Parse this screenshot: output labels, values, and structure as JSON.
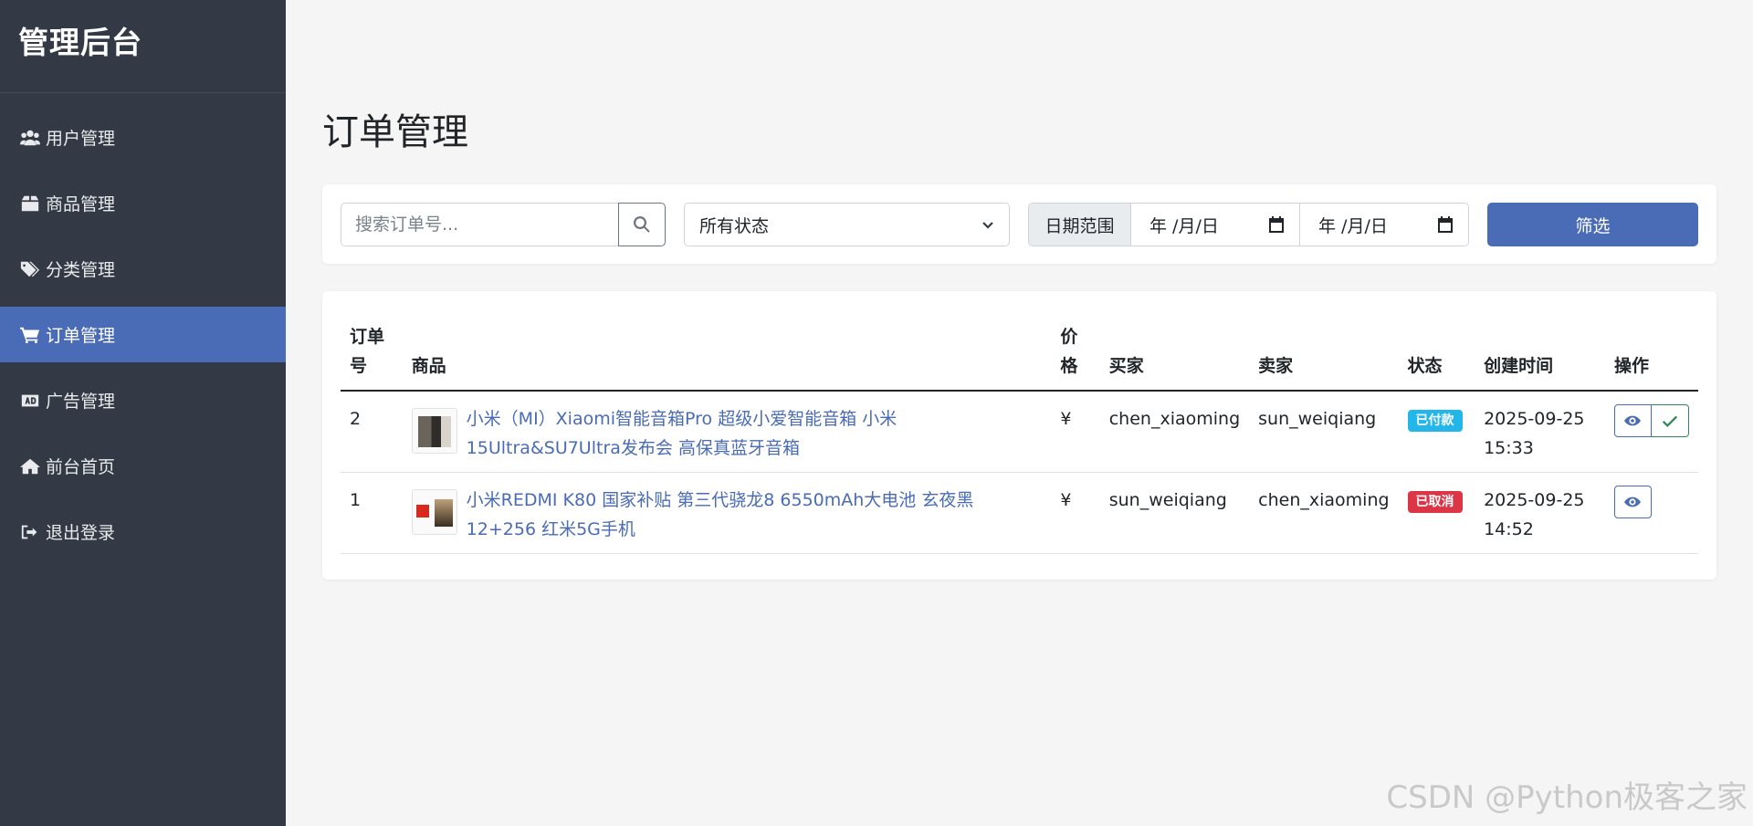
{
  "sidebar": {
    "brand": "管理后台",
    "items": [
      {
        "label": "用户管理",
        "icon": "users-icon"
      },
      {
        "label": "商品管理",
        "icon": "box-icon"
      },
      {
        "label": "分类管理",
        "icon": "tags-icon"
      },
      {
        "label": "订单管理",
        "icon": "cart-icon",
        "active": true
      },
      {
        "label": "广告管理",
        "icon": "ad-icon"
      },
      {
        "label": "前台首页",
        "icon": "home-icon"
      },
      {
        "label": "退出登录",
        "icon": "sign-out-icon"
      }
    ]
  },
  "page": {
    "title": "订单管理"
  },
  "filters": {
    "search_placeholder": "搜索订单号...",
    "status_selected": "所有状态",
    "date_range_label": "日期范围",
    "date_start": "年 /月/日",
    "date_end": "年 /月/日",
    "filter_button": "筛选"
  },
  "table": {
    "headers": [
      "订单号",
      "商品",
      "价格",
      "买家",
      "卖家",
      "状态",
      "创建时间",
      "操作"
    ],
    "rows": [
      {
        "id": "2",
        "product": "小米（MI）Xiaomi智能音箱Pro 超级小爱智能音箱 小米15Ultra&SU7Ultra发布会 高保真蓝牙音箱",
        "price": "¥",
        "buyer": "chen_xiaoming",
        "seller": "sun_weiqiang",
        "status": "已付款",
        "created": "2025-09-25 15:33"
      },
      {
        "id": "1",
        "product": "小米REDMI K80 国家补贴 第三代骁龙8 6550mAh大电池 玄夜黑 12+256 红米5G手机",
        "price": "¥",
        "buyer": "sun_weiqiang",
        "seller": "chen_xiaoming",
        "status": "已取消",
        "created": "2025-09-25 14:52"
      }
    ]
  },
  "watermark": "CSDN @Python极客之家",
  "colors": {
    "sidebar_bg": "#343a45",
    "accent": "#4a6bb5",
    "badge_paid": "#22b7e8",
    "badge_cancel": "#dc3545"
  }
}
